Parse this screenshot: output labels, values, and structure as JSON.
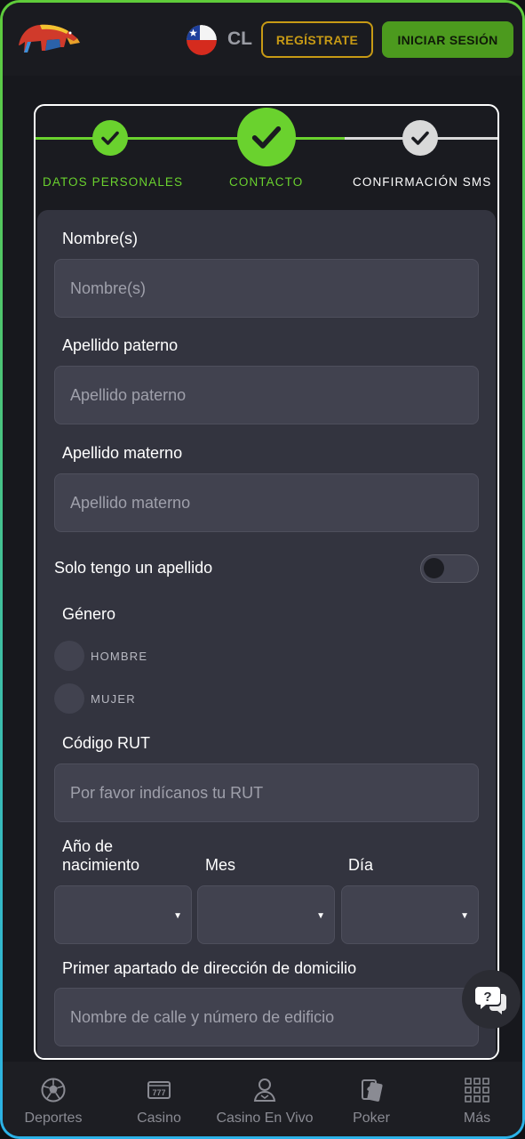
{
  "header": {
    "country_code": "CL",
    "register_label": "REGÍSTRATE",
    "login_label": "INICIAR SESIÓN"
  },
  "stepper": {
    "steps": [
      {
        "label": "DATOS PERSONALES",
        "state": "done"
      },
      {
        "label": "CONTACTO",
        "state": "current"
      },
      {
        "label": "CONFIRMACIÓN SMS",
        "state": "pending"
      }
    ],
    "active_color": "#6ad22e",
    "pending_color": "#d9d9d9"
  },
  "form": {
    "first_name": {
      "label": "Nombre(s)",
      "placeholder": "Nombre(s)",
      "value": ""
    },
    "paternal_surname": {
      "label": "Apellido paterno",
      "placeholder": "Apellido paterno",
      "value": ""
    },
    "maternal_surname": {
      "label": "Apellido materno",
      "placeholder": "Apellido materno",
      "value": ""
    },
    "single_surname": {
      "label": "Solo tengo un apellido",
      "on": false
    },
    "gender": {
      "label": "Género",
      "options": [
        "HOMBRE",
        "MUJER"
      ],
      "selected": null
    },
    "rut": {
      "label": "Código RUT",
      "placeholder": "Por favor indícanos tu RUT",
      "value": ""
    },
    "birth": {
      "year_label_line1": "Año de",
      "year_label_line2": "nacimiento",
      "month_label": "Mes",
      "day_label": "Día",
      "year_value": "",
      "month_value": "",
      "day_value": ""
    },
    "address1": {
      "label": "Primer apartado de dirección de domicilio",
      "placeholder": "Nombre de calle y número de edificio",
      "value": ""
    }
  },
  "bottom_nav": {
    "items": [
      {
        "label": "Deportes",
        "icon": "soccer-ball-icon"
      },
      {
        "label": "Casino",
        "icon": "slot-machine-icon"
      },
      {
        "label": "Casino En Vivo",
        "icon": "live-dealer-icon"
      },
      {
        "label": "Poker",
        "icon": "playing-cards-icon"
      },
      {
        "label": "Más",
        "icon": "grid-icon"
      }
    ]
  },
  "help": {
    "icon": "help-chat-icon"
  }
}
